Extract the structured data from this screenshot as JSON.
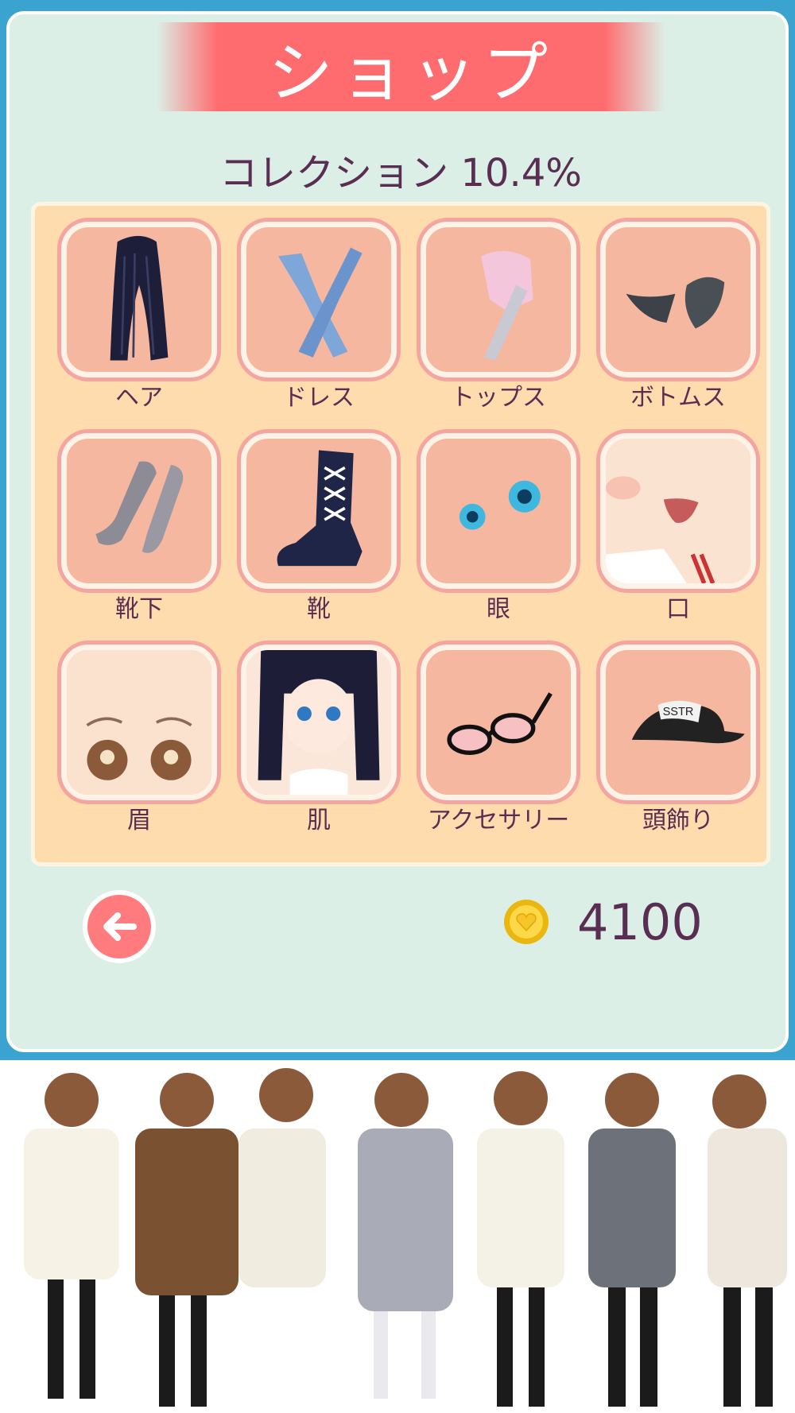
{
  "header": {
    "title": "ショップ"
  },
  "collection": {
    "label": "コレクション 10.4%"
  },
  "categories": [
    {
      "label": "ヘア",
      "icon": "hair-icon"
    },
    {
      "label": "ドレス",
      "icon": "dress-icon"
    },
    {
      "label": "トップス",
      "icon": "tops-icon"
    },
    {
      "label": "ボトムス",
      "icon": "bottoms-icon"
    },
    {
      "label": "靴下",
      "icon": "socks-icon"
    },
    {
      "label": "靴",
      "icon": "boot-icon"
    },
    {
      "label": "眼",
      "icon": "eyes-icon"
    },
    {
      "label": "口",
      "icon": "mouth-icon"
    },
    {
      "label": "眉",
      "icon": "eyebrows-icon"
    },
    {
      "label": "肌",
      "icon": "skin-icon"
    },
    {
      "label": "アクセサリー",
      "icon": "glasses-icon"
    },
    {
      "label": "頭飾り",
      "icon": "cap-icon"
    }
  ],
  "cap_text": "SSTR",
  "footer": {
    "coins": "4100",
    "back_icon": "back-arrow-icon",
    "coin_icon": "heart-coin-icon"
  },
  "colors": {
    "title_banner": "#ff6c6f",
    "panel": "#dcefe7",
    "board": "#ffdcae",
    "tile": "#f6b7a0",
    "text": "#5a2e52"
  }
}
